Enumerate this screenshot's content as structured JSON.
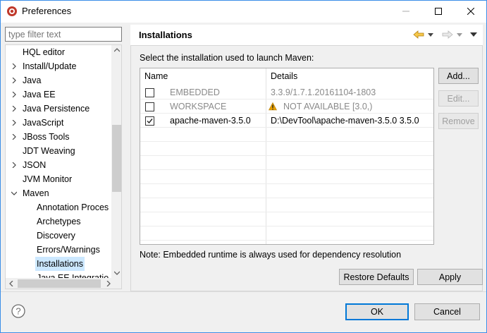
{
  "window": {
    "title": "Preferences",
    "accent": "#3b8ee8"
  },
  "filter": {
    "placeholder": "type filter text"
  },
  "tree": {
    "items": [
      {
        "label": "HQL editor",
        "expandable": false
      },
      {
        "label": "Install/Update",
        "expandable": true
      },
      {
        "label": "Java",
        "expandable": true
      },
      {
        "label": "Java EE",
        "expandable": true
      },
      {
        "label": "Java Persistence",
        "expandable": true
      },
      {
        "label": "JavaScript",
        "expandable": true
      },
      {
        "label": "JBoss Tools",
        "expandable": true
      },
      {
        "label": "JDT Weaving",
        "expandable": false
      },
      {
        "label": "JSON",
        "expandable": true
      },
      {
        "label": "JVM Monitor",
        "expandable": false
      },
      {
        "label": "Maven",
        "expandable": true,
        "expanded": true
      },
      {
        "label": "Annotation Proces",
        "child": true
      },
      {
        "label": "Archetypes",
        "child": true
      },
      {
        "label": "Discovery",
        "child": true
      },
      {
        "label": "Errors/Warnings",
        "child": true
      },
      {
        "label": "Installations",
        "child": true,
        "selected": true
      },
      {
        "label": "Java EE Integratio",
        "child": true
      }
    ]
  },
  "page": {
    "title": "Installations",
    "prompt": "Select the installation used to launch Maven:",
    "note": "Note: Embedded runtime is always used for dependency resolution"
  },
  "table": {
    "columns": [
      "Name",
      "Details"
    ],
    "rows": [
      {
        "checked": false,
        "name": "EMBEDDED",
        "details": "3.3.9/1.7.1.20161104-1803",
        "muted": true,
        "warning": false
      },
      {
        "checked": false,
        "name": "WORKSPACE",
        "details": "NOT AVAILABLE [3.0,)",
        "muted": true,
        "warning": true
      },
      {
        "checked": true,
        "name": "apache-maven-3.5.0",
        "details": "D:\\DevTool\\apache-maven-3.5.0 3.5.0",
        "muted": false,
        "warning": false
      }
    ]
  },
  "buttons": {
    "add": "Add...",
    "edit": "Edit...",
    "remove": "Remove",
    "restore_defaults": "Restore Defaults",
    "apply": "Apply",
    "ok": "OK",
    "cancel": "Cancel"
  },
  "icons": {
    "help": "help-icon",
    "back": "back-arrow-icon",
    "forward": "forward-arrow-icon",
    "menu": "view-menu-icon",
    "warning_color": "#e8a000"
  }
}
